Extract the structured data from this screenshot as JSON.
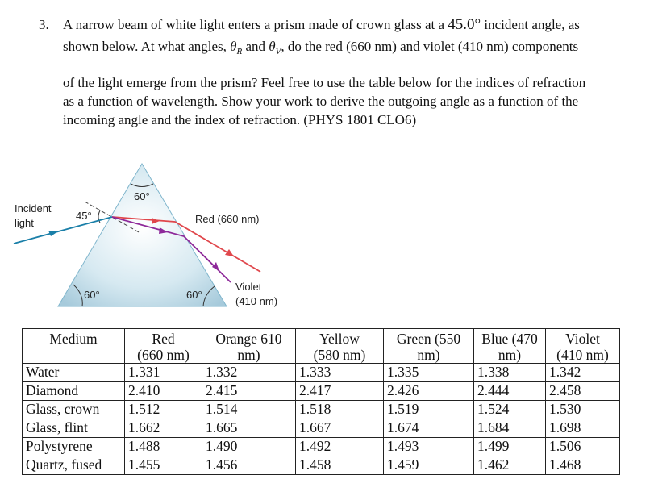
{
  "question": {
    "number": "3.",
    "line1_a": "A narrow beam of white light enters a prism made of crown glass at a",
    "line1_angle": "45.0°",
    "line1_b": "incident angle, as",
    "line2_a": "shown below. At what angles,",
    "theta_symbol": "θ",
    "theta_r_sub": "R",
    "and": "and",
    "theta_v_sub": "V",
    "line2_b": ", do the red (660 nm) and violet (410 nm) components",
    "line3": "of the light emerge from the prism?  Feel free to use the table below for the indices of refraction",
    "line4": "as a function of wavelength.   Show your work to derive the outgoing angle as a function of  the",
    "line5": "incoming angle and the index of refraction.    (PHYS 1801 CLO6)"
  },
  "diagram": {
    "incident_label_1": "Incident",
    "incident_label_2": "light",
    "incident_angle": "45°",
    "apex_angle": "60°",
    "left_base_angle": "60°",
    "right_base_angle": "60°",
    "red_label": "Red (660 nm)",
    "violet_label_1": "Violet",
    "violet_label_2": "(410 nm)",
    "colors": {
      "prism_fill": "#b9d6e3",
      "prism_edge": "#7fb5cc",
      "incident_ray": "#1a7fa8",
      "red_ray": "#e0474c",
      "violet_ray": "#8e2a9a"
    }
  },
  "table": {
    "headers": [
      [
        "Medium",
        ""
      ],
      [
        "Red",
        "(660 nm)"
      ],
      [
        "Orange 610",
        "nm)"
      ],
      [
        "Yellow",
        "(580 nm)"
      ],
      [
        "Green (550",
        "nm)"
      ],
      [
        "Blue (470",
        "nm)"
      ],
      [
        "Violet",
        "(410 nm)"
      ]
    ],
    "rows": [
      [
        "Water",
        "1.331",
        "1.332",
        "1.333",
        "1.335",
        "1.338",
        "1.342"
      ],
      [
        "Diamond",
        "2.410",
        "2.415",
        "2.417",
        "2.426",
        "2.444",
        "2.458"
      ],
      [
        "Glass, crown",
        "1.512",
        "1.514",
        "1.518",
        "1.519",
        "1.524",
        "1.530"
      ],
      [
        "Glass, flint",
        "1.662",
        "1.665",
        "1.667",
        "1.674",
        "1.684",
        "1.698"
      ],
      [
        "Polystyrene",
        "1.488",
        "1.490",
        "1.492",
        "1.493",
        "1.499",
        "1.506"
      ],
      [
        "Quartz, fused",
        "1.455",
        "1.456",
        "1.458",
        "1.459",
        "1.462",
        "1.468"
      ]
    ]
  }
}
